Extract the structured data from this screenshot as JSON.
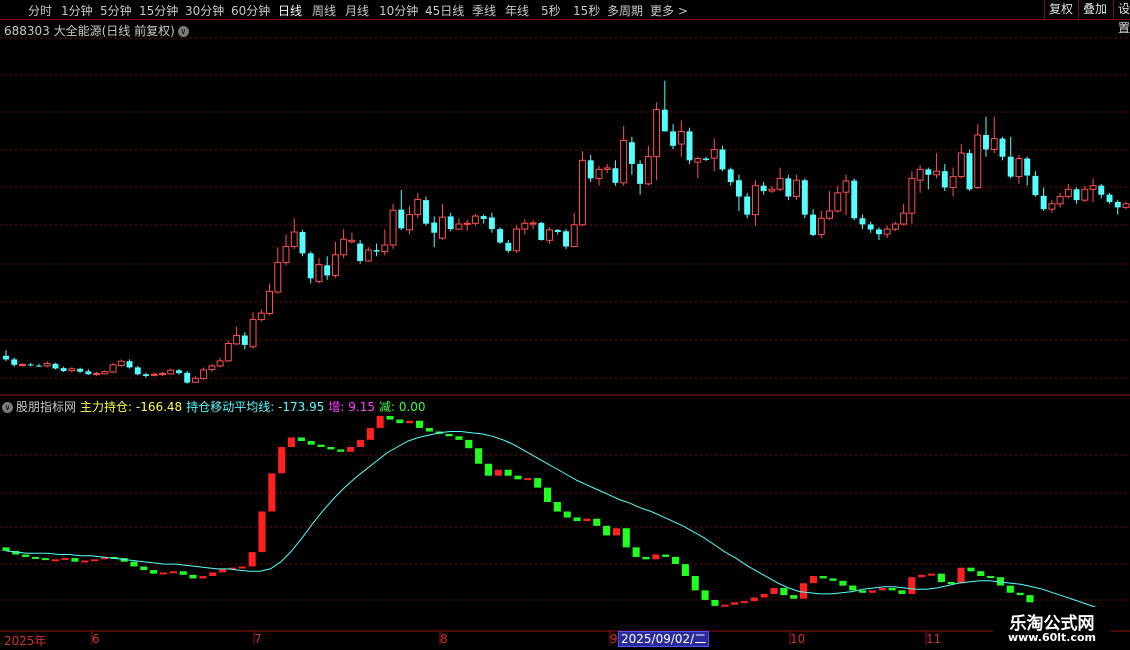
{
  "toolbar": {
    "periods": [
      "分时",
      "1分钟",
      "5分钟",
      "15分钟",
      "30分钟",
      "60分钟",
      "日线",
      "周线",
      "月线",
      "10分钟",
      "45日线",
      "季线",
      "年线",
      "5秒",
      "15秒",
      "多周期",
      "更多 >"
    ],
    "active_period": "日线",
    "right_buttons": [
      "复权",
      "叠加",
      "设置"
    ]
  },
  "main_chart": {
    "title": "688303 大全能源(日线 前复权)",
    "up_color": "#ff5050",
    "down_color": "#54ffff"
  },
  "indicator": {
    "name": "股朋指标网",
    "main_label": "主力持仓: -166.48",
    "ma_label": "持仓移动平均线: -173.95",
    "inc_label": "增: 9.15",
    "dec_label": "减: 0.00",
    "colors": {
      "name": "#c8c8c8",
      "main": "#ffff40",
      "ma": "#54ffff",
      "inc": "#ff40ff",
      "dec": "#40ff40"
    }
  },
  "time_axis": {
    "labels": [
      "2025年",
      "6",
      "7",
      "8",
      "9",
      "10",
      "11"
    ],
    "cursor_date": "2025/09/02/二"
  },
  "watermark": {
    "line1": "乐淘公式网",
    "line2": "www.60lt.com"
  },
  "chart_data": {
    "type": "candlestick",
    "candles": [
      [
        50,
        49,
        51.5,
        48.5
      ],
      [
        49,
        47.5,
        49.5,
        47
      ],
      [
        47.3,
        47.6,
        48,
        47
      ],
      [
        47.6,
        47.4,
        48,
        47.1
      ],
      [
        47.3,
        47.1,
        47.8,
        46.9
      ],
      [
        47.2,
        47.9,
        48.5,
        46.8
      ],
      [
        47.8,
        46.5,
        48,
        46.2
      ],
      [
        46.6,
        45.8,
        47,
        45.5
      ],
      [
        45.9,
        46.4,
        46.9,
        45.5
      ],
      [
        46.4,
        45.6,
        46.7,
        45.3
      ],
      [
        45.7,
        44.9,
        46.3,
        44.7
      ],
      [
        44.8,
        45.1,
        45.6,
        44.5
      ],
      [
        45,
        45.6,
        46,
        44.9
      ],
      [
        45.5,
        47.5,
        48,
        45.3
      ],
      [
        47.3,
        48.5,
        49,
        47
      ],
      [
        48.5,
        46.8,
        49,
        46.5
      ],
      [
        46.8,
        44.9,
        47.2,
        44.6
      ],
      [
        44.9,
        44.4,
        45.3,
        44
      ],
      [
        44.6,
        44.9,
        45.3,
        44.3
      ],
      [
        44.8,
        45.1,
        45.6,
        44.4
      ],
      [
        45,
        46,
        46.5,
        44.8
      ],
      [
        46,
        45.2,
        46.4,
        44.8
      ],
      [
        45.3,
        42.6,
        45.8,
        42.3
      ],
      [
        42.7,
        43.8,
        44.4,
        42.5
      ],
      [
        43.7,
        46.1,
        46.8,
        43.4
      ],
      [
        46.2,
        47.2,
        47.8,
        45.7
      ],
      [
        47.2,
        48.6,
        49.5,
        46.8
      ],
      [
        48.6,
        53.4,
        54.2,
        48.3
      ],
      [
        53.3,
        55.6,
        58,
        53
      ],
      [
        55.6,
        53,
        56.5,
        51.8
      ],
      [
        52.5,
        60,
        62,
        52
      ],
      [
        60,
        61.8,
        62.8,
        59.5
      ],
      [
        61.7,
        67.8,
        70,
        61.2
      ],
      [
        67.6,
        75.8,
        80,
        67.2
      ],
      [
        75.8,
        80.2,
        83.5,
        75
      ],
      [
        80.2,
        84.2,
        88,
        79.5
      ],
      [
        84.2,
        78.3,
        84.8,
        77.5
      ],
      [
        78.3,
        71.4,
        78.8,
        70
      ],
      [
        70.5,
        75.2,
        77,
        70
      ],
      [
        75,
        72.2,
        77.5,
        71
      ],
      [
        72.2,
        77.9,
        81.5,
        71.5
      ],
      [
        77.9,
        82.2,
        85,
        77
      ],
      [
        81.5,
        81.9,
        84,
        81
      ],
      [
        81,
        76.2,
        82,
        75.5
      ],
      [
        76.2,
        79.2,
        80,
        76
      ],
      [
        79.2,
        78.8,
        81,
        77.5
      ],
      [
        78.8,
        80.6,
        85,
        77.7
      ],
      [
        80.6,
        90.2,
        92,
        79.5
      ],
      [
        90.4,
        85.2,
        95.8,
        84.7
      ],
      [
        84.8,
        89,
        91.5,
        83.6
      ],
      [
        89,
        93.2,
        95,
        88
      ],
      [
        93,
        86.5,
        94,
        86
      ],
      [
        86.8,
        84,
        88.5,
        80
      ],
      [
        82.5,
        88.3,
        92,
        82
      ],
      [
        88.5,
        85,
        89.5,
        84.4
      ],
      [
        85,
        86.4,
        88,
        84.8
      ],
      [
        86.5,
        86.6,
        87.6,
        84.5
      ],
      [
        86.6,
        88.6,
        89.2,
        86
      ],
      [
        88.6,
        87.8,
        89,
        86.5
      ],
      [
        88.2,
        85,
        89.5,
        84
      ],
      [
        85,
        81.3,
        85.5,
        80.9
      ],
      [
        81.2,
        79,
        82,
        78.5
      ],
      [
        79,
        85,
        86,
        78.5
      ],
      [
        85,
        86.6,
        87.7,
        83.5
      ],
      [
        86.4,
        86.7,
        87.5,
        85
      ],
      [
        86.7,
        82,
        87,
        81.8
      ],
      [
        81.9,
        84.8,
        85.5,
        80.9
      ],
      [
        84.8,
        84.2,
        85,
        83.5
      ],
      [
        84.4,
        80.2,
        85,
        79.5
      ],
      [
        80.2,
        86.2,
        89.5,
        80
      ],
      [
        86.2,
        104,
        106.5,
        85.8
      ],
      [
        104,
        99,
        105.5,
        98
      ],
      [
        99,
        101.5,
        102.5,
        97
      ],
      [
        101.5,
        101.9,
        103,
        100.5
      ],
      [
        101.8,
        97.8,
        104,
        97
      ],
      [
        97.8,
        109.5,
        113.5,
        97
      ],
      [
        109,
        103,
        110.5,
        100
      ],
      [
        103,
        97.5,
        104,
        94.5
      ],
      [
        97.5,
        105,
        108,
        97
      ],
      [
        105,
        118,
        120,
        98.5
      ],
      [
        118,
        112,
        126,
        112
      ],
      [
        112,
        108,
        114,
        107
      ],
      [
        108.5,
        112,
        115,
        105
      ],
      [
        112,
        104,
        113,
        103
      ],
      [
        103.5,
        104.5,
        105,
        99
      ],
      [
        104.5,
        104.1,
        105,
        103.8
      ],
      [
        104.6,
        107,
        110,
        101
      ],
      [
        107,
        101.5,
        108,
        101
      ],
      [
        101.5,
        98,
        102,
        97
      ],
      [
        98.5,
        94,
        100,
        90
      ],
      [
        94,
        89,
        95,
        88
      ],
      [
        89,
        97,
        98.5,
        86
      ],
      [
        97,
        95.5,
        98,
        94.5
      ],
      [
        95.5,
        96,
        97,
        95
      ],
      [
        96,
        99,
        102,
        95.5
      ],
      [
        99,
        94,
        100,
        93
      ],
      [
        94,
        98.5,
        100,
        93
      ],
      [
        98.5,
        89,
        99,
        88
      ],
      [
        89,
        83.4,
        90.5,
        83
      ],
      [
        83.5,
        88,
        90,
        82.5
      ],
      [
        88,
        90,
        95.5,
        87.5
      ],
      [
        90,
        95,
        97,
        89.5
      ],
      [
        95.2,
        98.3,
        100,
        88.8
      ],
      [
        98.4,
        88,
        99,
        87.5
      ],
      [
        88,
        86.3,
        89,
        85
      ],
      [
        86.3,
        84.9,
        87,
        84
      ],
      [
        84.9,
        83.6,
        85.5,
        82
      ],
      [
        83.6,
        85,
        86,
        82.5
      ],
      [
        85,
        86.4,
        87,
        84.5
      ],
      [
        86.4,
        89.4,
        92,
        86
      ],
      [
        89.4,
        99,
        101,
        86.5
      ],
      [
        98.5,
        101.5,
        102.7,
        95
      ],
      [
        101.5,
        100,
        102,
        96
      ],
      [
        100,
        101,
        106,
        99
      ],
      [
        101,
        96.5,
        103,
        95.5
      ],
      [
        96.5,
        99.5,
        102,
        94
      ],
      [
        99.5,
        106,
        108.5,
        99
      ],
      [
        106,
        96,
        107,
        95.5
      ],
      [
        96.5,
        111,
        114,
        96
      ],
      [
        111,
        107,
        116,
        105
      ],
      [
        107,
        110,
        116,
        106
      ],
      [
        110,
        105,
        110.5,
        104
      ],
      [
        105,
        99.5,
        110.5,
        99
      ],
      [
        99.5,
        104.5,
        105.5,
        97.5
      ],
      [
        104.5,
        99.8,
        105,
        97
      ],
      [
        99.7,
        94.4,
        101,
        94
      ],
      [
        94.2,
        90.5,
        96.5,
        90
      ],
      [
        90.5,
        92,
        93,
        89.5
      ],
      [
        92,
        94,
        95,
        91
      ],
      [
        94,
        96,
        97.5,
        93.5
      ],
      [
        96,
        93,
        96.5,
        92
      ],
      [
        93,
        96,
        97,
        92.5
      ],
      [
        96,
        97,
        99,
        92.5
      ],
      [
        97,
        94.5,
        97.5,
        93.5
      ],
      [
        94.5,
        92.5,
        95,
        92
      ],
      [
        92.5,
        91,
        93,
        89
      ],
      [
        91,
        92,
        92.5,
        90.5
      ]
    ],
    "y_scale_main": [
      40,
      140
    ],
    "indicator": {
      "main_series_name": "主力持仓",
      "main_bars": [
        [
          -120,
          -123
        ],
        [
          -123,
          -126
        ],
        [
          -126,
          -128
        ],
        [
          -128,
          -129
        ],
        [
          -129,
          -130
        ],
        [
          -130,
          -130
        ],
        [
          -130,
          -129
        ],
        [
          -129,
          -132
        ],
        [
          -132,
          -131
        ],
        [
          -131,
          -130
        ],
        [
          -130,
          -128
        ],
        [
          -128,
          -129
        ],
        [
          -129,
          -132
        ],
        [
          -132,
          -136
        ],
        [
          -136,
          -139
        ],
        [
          -139,
          -142
        ],
        [
          -142,
          -141
        ],
        [
          -141,
          -140
        ],
        [
          -140,
          -143
        ],
        [
          -143,
          -146
        ],
        [
          -146,
          -144
        ],
        [
          -144,
          -141
        ],
        [
          -141,
          -138
        ],
        [
          -138,
          -137
        ],
        [
          -137,
          -136
        ],
        [
          -136,
          -124
        ],
        [
          -124,
          -90
        ],
        [
          -90,
          -58
        ],
        [
          -58,
          -36
        ],
        [
          -36,
          -28
        ],
        [
          -28,
          -31
        ],
        [
          -31,
          -34
        ],
        [
          -34,
          -36
        ],
        [
          -36,
          -38
        ],
        [
          -38,
          -40
        ],
        [
          -40,
          -36
        ],
        [
          -36,
          -30
        ],
        [
          -30,
          -20
        ],
        [
          -20,
          -10
        ],
        [
          -10,
          -13
        ],
        [
          -13,
          -16
        ],
        [
          -16,
          -14
        ],
        [
          -14,
          -20
        ],
        [
          -20,
          -23
        ],
        [
          -23,
          -25
        ],
        [
          -25,
          -27
        ],
        [
          -27,
          -30
        ],
        [
          -30,
          -37
        ],
        [
          -37,
          -50
        ],
        [
          -50,
          -60
        ],
        [
          -60,
          -55
        ],
        [
          -55,
          -60
        ],
        [
          -60,
          -63
        ],
        [
          -63,
          -62
        ],
        [
          -62,
          -70
        ],
        [
          -70,
          -82
        ],
        [
          -82,
          -90
        ],
        [
          -90,
          -95
        ],
        [
          -95,
          -98
        ],
        [
          -98,
          -96
        ],
        [
          -96,
          -102
        ],
        [
          -102,
          -110
        ],
        [
          -110,
          -104
        ],
        [
          -104,
          -120
        ],
        [
          -120,
          -128
        ],
        [
          -128,
          -130
        ],
        [
          -130,
          -126
        ],
        [
          -126,
          -128
        ],
        [
          -128,
          -134
        ],
        [
          -134,
          -144
        ],
        [
          -144,
          -156
        ],
        [
          -156,
          -164
        ],
        [
          -164,
          -169
        ],
        [
          -169,
          -168
        ],
        [
          -168,
          -166
        ],
        [
          -166,
          -165
        ],
        [
          -165,
          -162
        ],
        [
          -162,
          -159
        ],
        [
          -159,
          -154
        ],
        [
          -154,
          -160
        ],
        [
          -160,
          -163
        ],
        [
          -163,
          -150
        ],
        [
          -150,
          -144
        ],
        [
          -144,
          -146
        ],
        [
          -146,
          -148
        ],
        [
          -148,
          -152
        ],
        [
          -152,
          -156
        ],
        [
          -156,
          -158
        ],
        [
          -158,
          -156
        ],
        [
          -156,
          -154
        ],
        [
          -154,
          -156
        ],
        [
          -156,
          -159
        ],
        [
          -159,
          -145
        ],
        [
          -145,
          -143
        ],
        [
          -143,
          -142
        ],
        [
          -142,
          -149
        ],
        [
          -149,
          -150
        ],
        [
          -150,
          -137
        ],
        [
          -137,
          -140
        ],
        [
          -140,
          -144
        ],
        [
          -144,
          -145
        ],
        [
          -145,
          -152
        ],
        [
          -152,
          -158
        ],
        [
          -158,
          -160
        ],
        [
          -160,
          -166
        ]
      ],
      "ma_series_name": "持仓移动平均线",
      "ma_values": [
        -123,
        -124,
        -125,
        -125,
        -125,
        -126,
        -126,
        -127,
        -127,
        -128,
        -129,
        -130,
        -131,
        -132,
        -133,
        -134,
        -134,
        -135,
        -136,
        -137,
        -138,
        -138,
        -139,
        -140,
        -140,
        -138,
        -132,
        -123,
        -112,
        -100,
        -89,
        -79,
        -70,
        -62,
        -55,
        -48,
        -41,
        -36,
        -31,
        -28,
        -26,
        -24,
        -23,
        -23,
        -24,
        -25,
        -27,
        -30,
        -34,
        -39,
        -44,
        -49,
        -54,
        -59,
        -64,
        -68,
        -72,
        -76,
        -80,
        -83,
        -87,
        -90,
        -94,
        -98,
        -102,
        -107,
        -112,
        -118,
        -124,
        -129,
        -135,
        -140,
        -145,
        -150,
        -154,
        -157,
        -158,
        -159,
        -159,
        -158,
        -157,
        -155,
        -154,
        -153,
        -153,
        -154,
        -155,
        -155,
        -154,
        -152,
        -150,
        -149,
        -148,
        -148,
        -149,
        -150,
        -151,
        -153,
        -155,
        -158,
        -161,
        -164,
        -167,
        -170,
        -173
      ]
    },
    "y_scale_indicator": [
      -185,
      -5
    ]
  }
}
